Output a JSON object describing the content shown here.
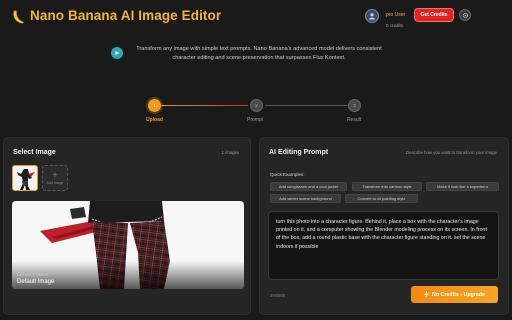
{
  "header": {
    "title": "Nano Banana AI Image Editor",
    "user_name": "pro User",
    "credits": "0 credits",
    "get_credits_label": "Get Credits",
    "logo_icon": "banana-icon",
    "accent": "#f2b531"
  },
  "description": {
    "text": "Transform any image with simple text prompts. Nano Banana's advanced model delivers consistent character editing and scene preservation that surpasses Flux Kontext."
  },
  "steps": [
    {
      "number": "1",
      "label": "Upload",
      "state": "active"
    },
    {
      "number": "2",
      "label": "Prompt",
      "state": "inactive"
    },
    {
      "number": "3",
      "label": "Result",
      "state": "inactive"
    }
  ],
  "select_image": {
    "title": "Select Image",
    "count": "1 images",
    "add_label": "Add Image",
    "preview_caption": "Default Image",
    "preview_tag": "DEFAULT IMAGE"
  },
  "prompt_panel": {
    "title": "AI Editing Prompt",
    "hint": "Describe how you want to transform your image",
    "quick_label": "Quick Examples:",
    "chips": [
      "Add sunglasses and a cool jacket",
      "Transform into cartoon style",
      "Make it look like a superhero",
      "Add winter scene background",
      "Convert to oil painting style"
    ],
    "prompt_text": "turn this photo into a character figure. Behind it, place a box with the character's image printed on it, and a computer showing the Blender modeling process on its screen. In front of the box, add a round plastic base with the character figure standing on it. set the scene indoors if possible",
    "counter": "294/500",
    "cta_label": "No Credits - Upgrade"
  },
  "colors": {
    "orange": "#f29a1b",
    "red": "#e02424",
    "teal": "#2fa6b8"
  }
}
